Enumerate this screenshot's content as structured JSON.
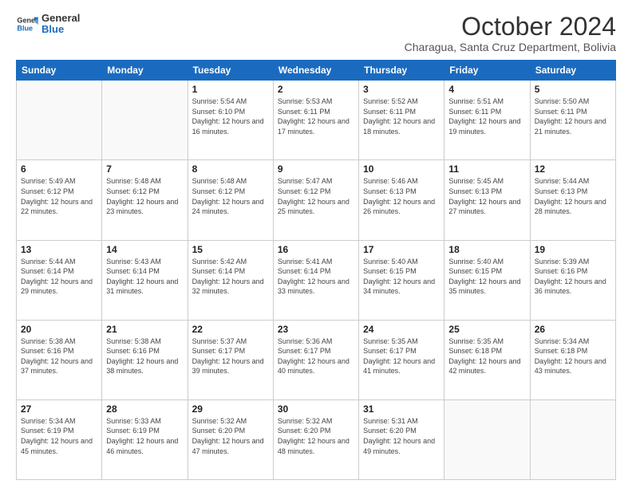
{
  "header": {
    "logo_general": "General",
    "logo_blue": "Blue",
    "month_title": "October 2024",
    "subtitle": "Charagua, Santa Cruz Department, Bolivia"
  },
  "days_of_week": [
    "Sunday",
    "Monday",
    "Tuesday",
    "Wednesday",
    "Thursday",
    "Friday",
    "Saturday"
  ],
  "weeks": [
    [
      {
        "day": "",
        "info": ""
      },
      {
        "day": "",
        "info": ""
      },
      {
        "day": "1",
        "info": "Sunrise: 5:54 AM\nSunset: 6:10 PM\nDaylight: 12 hours and 16 minutes."
      },
      {
        "day": "2",
        "info": "Sunrise: 5:53 AM\nSunset: 6:11 PM\nDaylight: 12 hours and 17 minutes."
      },
      {
        "day": "3",
        "info": "Sunrise: 5:52 AM\nSunset: 6:11 PM\nDaylight: 12 hours and 18 minutes."
      },
      {
        "day": "4",
        "info": "Sunrise: 5:51 AM\nSunset: 6:11 PM\nDaylight: 12 hours and 19 minutes."
      },
      {
        "day": "5",
        "info": "Sunrise: 5:50 AM\nSunset: 6:11 PM\nDaylight: 12 hours and 21 minutes."
      }
    ],
    [
      {
        "day": "6",
        "info": "Sunrise: 5:49 AM\nSunset: 6:12 PM\nDaylight: 12 hours and 22 minutes."
      },
      {
        "day": "7",
        "info": "Sunrise: 5:48 AM\nSunset: 6:12 PM\nDaylight: 12 hours and 23 minutes."
      },
      {
        "day": "8",
        "info": "Sunrise: 5:48 AM\nSunset: 6:12 PM\nDaylight: 12 hours and 24 minutes."
      },
      {
        "day": "9",
        "info": "Sunrise: 5:47 AM\nSunset: 6:12 PM\nDaylight: 12 hours and 25 minutes."
      },
      {
        "day": "10",
        "info": "Sunrise: 5:46 AM\nSunset: 6:13 PM\nDaylight: 12 hours and 26 minutes."
      },
      {
        "day": "11",
        "info": "Sunrise: 5:45 AM\nSunset: 6:13 PM\nDaylight: 12 hours and 27 minutes."
      },
      {
        "day": "12",
        "info": "Sunrise: 5:44 AM\nSunset: 6:13 PM\nDaylight: 12 hours and 28 minutes."
      }
    ],
    [
      {
        "day": "13",
        "info": "Sunrise: 5:44 AM\nSunset: 6:14 PM\nDaylight: 12 hours and 29 minutes."
      },
      {
        "day": "14",
        "info": "Sunrise: 5:43 AM\nSunset: 6:14 PM\nDaylight: 12 hours and 31 minutes."
      },
      {
        "day": "15",
        "info": "Sunrise: 5:42 AM\nSunset: 6:14 PM\nDaylight: 12 hours and 32 minutes."
      },
      {
        "day": "16",
        "info": "Sunrise: 5:41 AM\nSunset: 6:14 PM\nDaylight: 12 hours and 33 minutes."
      },
      {
        "day": "17",
        "info": "Sunrise: 5:40 AM\nSunset: 6:15 PM\nDaylight: 12 hours and 34 minutes."
      },
      {
        "day": "18",
        "info": "Sunrise: 5:40 AM\nSunset: 6:15 PM\nDaylight: 12 hours and 35 minutes."
      },
      {
        "day": "19",
        "info": "Sunrise: 5:39 AM\nSunset: 6:16 PM\nDaylight: 12 hours and 36 minutes."
      }
    ],
    [
      {
        "day": "20",
        "info": "Sunrise: 5:38 AM\nSunset: 6:16 PM\nDaylight: 12 hours and 37 minutes."
      },
      {
        "day": "21",
        "info": "Sunrise: 5:38 AM\nSunset: 6:16 PM\nDaylight: 12 hours and 38 minutes."
      },
      {
        "day": "22",
        "info": "Sunrise: 5:37 AM\nSunset: 6:17 PM\nDaylight: 12 hours and 39 minutes."
      },
      {
        "day": "23",
        "info": "Sunrise: 5:36 AM\nSunset: 6:17 PM\nDaylight: 12 hours and 40 minutes."
      },
      {
        "day": "24",
        "info": "Sunrise: 5:35 AM\nSunset: 6:17 PM\nDaylight: 12 hours and 41 minutes."
      },
      {
        "day": "25",
        "info": "Sunrise: 5:35 AM\nSunset: 6:18 PM\nDaylight: 12 hours and 42 minutes."
      },
      {
        "day": "26",
        "info": "Sunrise: 5:34 AM\nSunset: 6:18 PM\nDaylight: 12 hours and 43 minutes."
      }
    ],
    [
      {
        "day": "27",
        "info": "Sunrise: 5:34 AM\nSunset: 6:19 PM\nDaylight: 12 hours and 45 minutes."
      },
      {
        "day": "28",
        "info": "Sunrise: 5:33 AM\nSunset: 6:19 PM\nDaylight: 12 hours and 46 minutes."
      },
      {
        "day": "29",
        "info": "Sunrise: 5:32 AM\nSunset: 6:20 PM\nDaylight: 12 hours and 47 minutes."
      },
      {
        "day": "30",
        "info": "Sunrise: 5:32 AM\nSunset: 6:20 PM\nDaylight: 12 hours and 48 minutes."
      },
      {
        "day": "31",
        "info": "Sunrise: 5:31 AM\nSunset: 6:20 PM\nDaylight: 12 hours and 49 minutes."
      },
      {
        "day": "",
        "info": ""
      },
      {
        "day": "",
        "info": ""
      }
    ]
  ]
}
